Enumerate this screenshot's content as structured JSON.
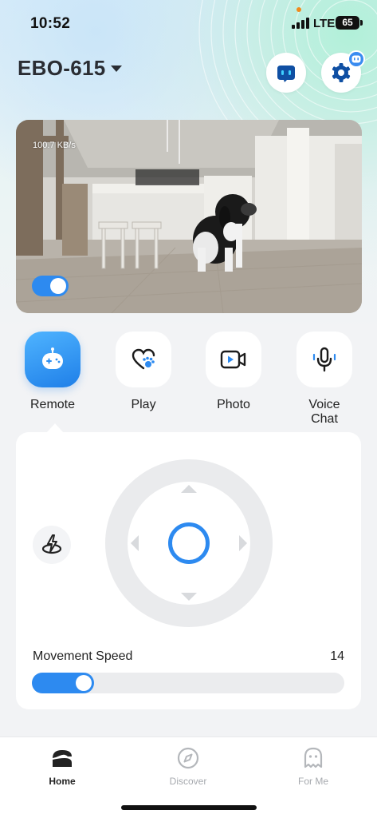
{
  "status_bar": {
    "time": "10:52",
    "network": "LTE",
    "battery": "65"
  },
  "header": {
    "device_name": "EBO-615",
    "robot_icon": "robot-face-icon",
    "settings_icon": "gear-icon",
    "badge_icon": "robot-face-icon"
  },
  "camera": {
    "bitrate": "100.7 KB/s",
    "toggle_on": true
  },
  "modes": [
    {
      "label": "Remote",
      "icon": "gamepad-icon",
      "active": true
    },
    {
      "label": "Play",
      "icon": "heart-paw-icon",
      "active": false
    },
    {
      "label": "Photo",
      "icon": "video-camera-icon",
      "active": false
    },
    {
      "label": "Voice\nChat",
      "icon": "microphone-icon",
      "active": false
    }
  ],
  "remote": {
    "jump_icon": "jump-icon",
    "speed_label": "Movement Speed",
    "speed_value": "14",
    "speed_fraction": 0.2
  },
  "bottom_nav": [
    {
      "label": "Home",
      "icon": "home-icon",
      "active": true
    },
    {
      "label": "Discover",
      "icon": "compass-icon",
      "active": false
    },
    {
      "label": "For Me",
      "icon": "ghost-icon",
      "active": false
    }
  ],
  "colors": {
    "accent": "#2d8af0",
    "active_tile_top": "#4fb4ff",
    "active_tile_bottom": "#1f7fe8",
    "inactive_label": "#a6a9ae"
  }
}
